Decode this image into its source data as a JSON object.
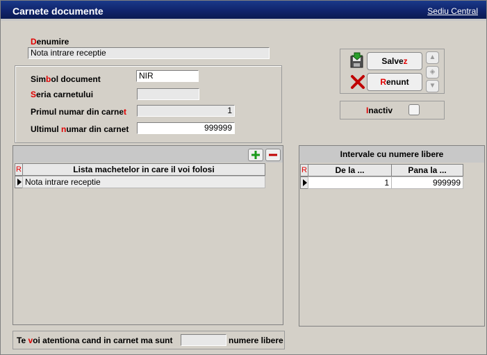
{
  "window": {
    "title": "Carnete documente",
    "link": "Sediu Central"
  },
  "form": {
    "denumire": {
      "label_hl": "D",
      "label_rest": "enumire",
      "value": "Nota intrare receptie"
    },
    "simbol": {
      "label_pre": "Sim",
      "label_hl": "b",
      "label_post": "ol document",
      "value": "NIR"
    },
    "seria": {
      "label_hl": "S",
      "label_rest": "eria carnetului",
      "value": ""
    },
    "primul": {
      "label_pre": "Primul numar din carne",
      "label_hl": "t",
      "value": "1"
    },
    "ultimul": {
      "label_pre": "Ultimul ",
      "label_hl": "n",
      "label_post": "umar din carnet",
      "value": "999999"
    }
  },
  "buttons": {
    "save": {
      "pre": "Salve",
      "hl": "z"
    },
    "cancel": {
      "hl": "R",
      "post": "enunt"
    }
  },
  "inactiv": {
    "hl": "I",
    "rest": "nactiv",
    "checked": false
  },
  "macheta_grid": {
    "header_marker": "R",
    "column": "Lista machetelor in care il voi folosi",
    "rows": [
      "Nota intrare receptie"
    ]
  },
  "intervale": {
    "title": "Intervale cu numere libere",
    "header_marker": "R",
    "columns": [
      "De la ...",
      "Pana la ..."
    ],
    "rows": [
      {
        "de_la": "1",
        "pana_la": "999999"
      }
    ]
  },
  "footer": {
    "pre": "Te ",
    "hl": "v",
    "mid": "oi atentiona cand in carnet ma sunt",
    "value": "",
    "post": "numere libere"
  },
  "colors": {
    "title_bar": "#10246c",
    "accent": "#e00000",
    "background": "#d4d0c8"
  }
}
